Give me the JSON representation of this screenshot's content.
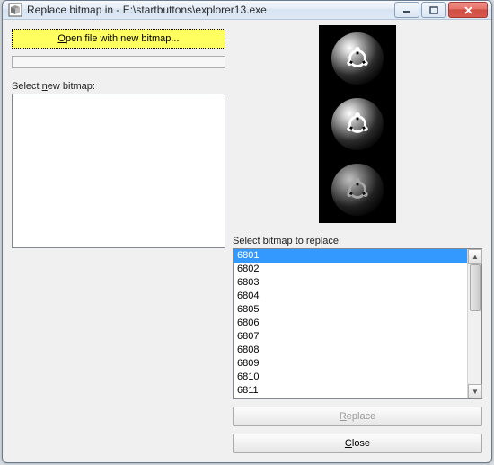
{
  "window": {
    "title": "Replace bitmap in - E:\\startbuttons\\explorer13.exe"
  },
  "left": {
    "openButton": {
      "pre": "",
      "accel": "O",
      "post": "pen file with new bitmap..."
    },
    "selectNew": {
      "pre": "Select ",
      "accel": "n",
      "post": "ew bitmap:"
    }
  },
  "right": {
    "selectReplace": "Select bitmap to replace:",
    "items": [
      "6801",
      "6802",
      "6803",
      "6804",
      "6805",
      "6806",
      "6807",
      "6808",
      "6809",
      "6810",
      "6811"
    ],
    "selectedIndex": 0,
    "replaceBtn": {
      "pre": "",
      "accel": "R",
      "post": "eplace"
    },
    "closeBtn": {
      "pre": "",
      "accel": "C",
      "post": "lose"
    }
  }
}
